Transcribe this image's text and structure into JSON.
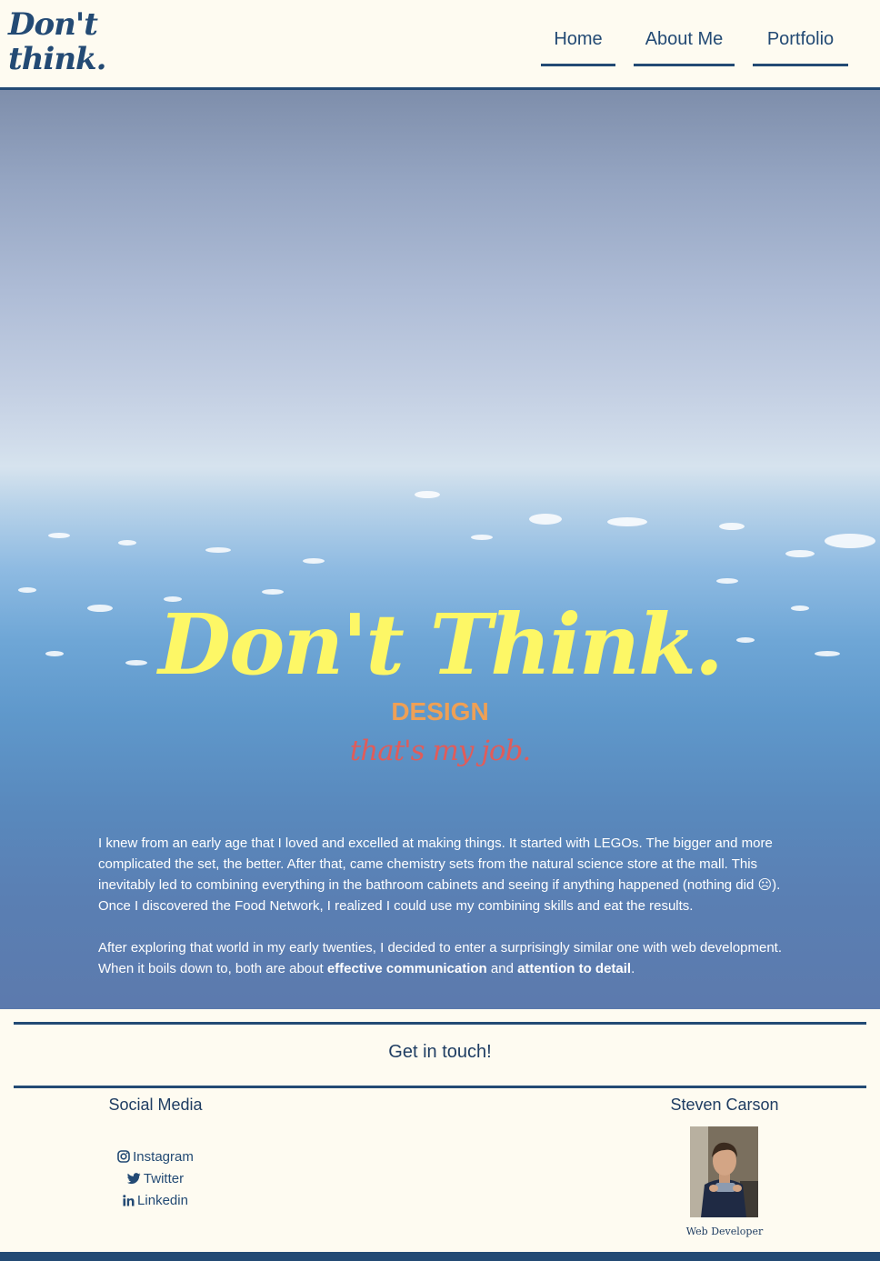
{
  "header": {
    "logo_line1": "Don't",
    "logo_line2": "think.",
    "nav": [
      {
        "label": "Home"
      },
      {
        "label": "About Me"
      },
      {
        "label": "Portfolio"
      }
    ]
  },
  "hero": {
    "title": "Don't Think.",
    "subtitle": "DESIGN",
    "tagline": "that's my job.",
    "paragraph1": "I knew from an early age that I loved and excelled at making things. It started with LEGOs. The bigger and more complicated the set, the better. After that, came chemistry sets from the natural science store at the mall. This inevitably led to combining everything in the bathroom cabinets and seeing if anything happened (nothing did ☹). Once I discovered the Food Network, I realized I could use my combining skills and eat the results.",
    "paragraph2_start": "After exploring that world in my early twenties, I decided to enter a surprisingly similar one with web development. When it boils down to, both are about ",
    "paragraph2_bold1": "effective communication",
    "paragraph2_mid": " and ",
    "paragraph2_bold2": "attention to detail",
    "paragraph2_end": "."
  },
  "footer": {
    "contact_title": "Get in touch!",
    "social_title": "Social Media",
    "social_links": [
      {
        "label": "Instagram",
        "icon": "instagram-icon"
      },
      {
        "label": "Twitter",
        "icon": "twitter-icon"
      },
      {
        "label": "Linkedin",
        "icon": "linkedin-icon"
      }
    ],
    "person_name": "Steven Carson",
    "person_role": "Web Developer"
  },
  "colors": {
    "accent": "#234a74",
    "background": "#fefbf1",
    "title_yellow": "#fdf766",
    "design_orange": "#efa055",
    "tagline_red": "#e05c5a"
  }
}
